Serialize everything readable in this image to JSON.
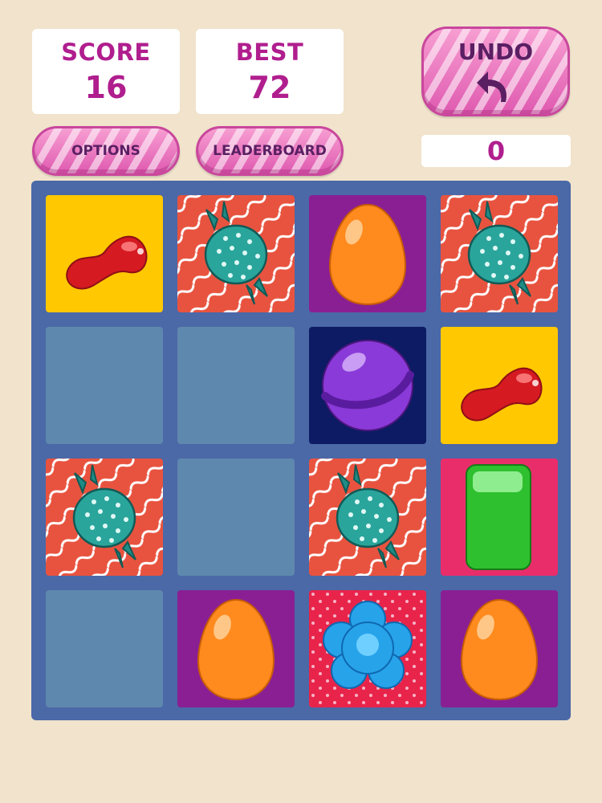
{
  "score": {
    "label": "SCORE",
    "value": "16"
  },
  "best": {
    "label": "BEST",
    "value": "72"
  },
  "undo": {
    "label": "UNDO",
    "count": "0"
  },
  "buttons": {
    "options": "OPTIONS",
    "leaderboard": "LEADERBOARD"
  },
  "board": {
    "rows": [
      [
        "jellybean",
        "wrapped-candy",
        "orange-egg",
        "wrapped-candy"
      ],
      [
        "empty",
        "empty",
        "purple-ball",
        "jellybean"
      ],
      [
        "wrapped-candy",
        "empty",
        "wrapped-candy",
        "green-gummy"
      ],
      [
        "empty",
        "orange-egg",
        "blue-flower",
        "orange-egg"
      ]
    ]
  }
}
